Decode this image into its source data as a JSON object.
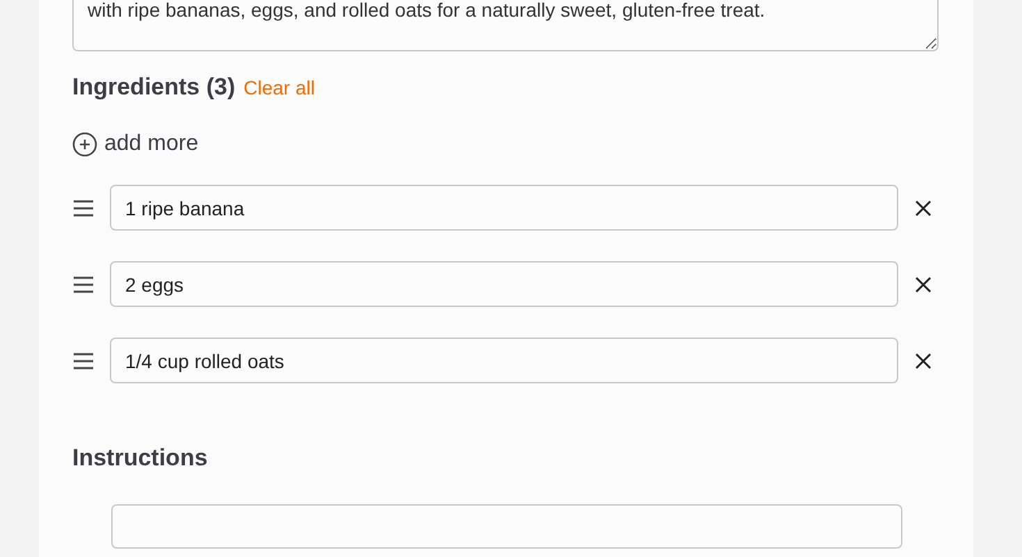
{
  "description": {
    "value": "with ripe bananas, eggs, and rolled oats for a naturally sweet, gluten-free treat."
  },
  "ingredients": {
    "title": "Ingredients (3)",
    "clear_label": "Clear all",
    "add_label": "add more",
    "items": [
      {
        "value": "1 ripe banana"
      },
      {
        "value": "2 eggs"
      },
      {
        "value": "1/4 cup rolled oats"
      }
    ]
  },
  "instructions": {
    "title": "Instructions"
  }
}
